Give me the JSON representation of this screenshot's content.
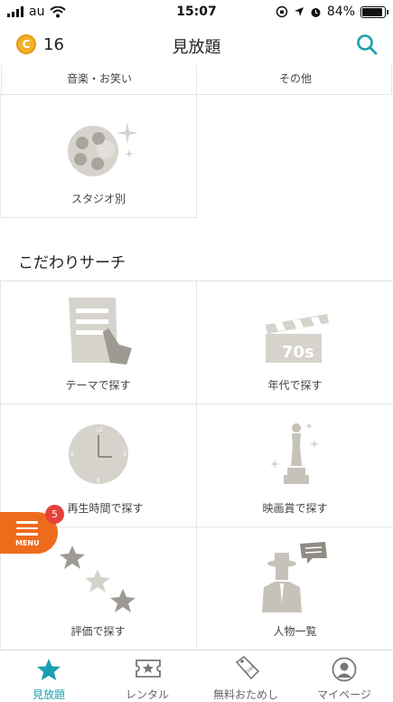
{
  "status": {
    "carrier": "au",
    "time": "15:07",
    "battery": "84%"
  },
  "header": {
    "coin_symbol": "C",
    "coins": "16",
    "title": "見放題"
  },
  "categories_top": {
    "left": "音楽・お笑い",
    "right": "その他"
  },
  "categories": [
    {
      "label": "スタジオ別"
    }
  ],
  "search_section": {
    "title": "こだわりサーチ",
    "items": [
      {
        "label": "テーマで探す",
        "icon": "document-hand-icon"
      },
      {
        "label": "年代で探す",
        "icon": "clapperboard-icon",
        "icon_text": "70s"
      },
      {
        "label": "再生時間で探す",
        "icon": "clock-icon"
      },
      {
        "label": "映画賞で探す",
        "icon": "trophy-icon"
      },
      {
        "label": "評価で探す",
        "icon": "stars-icon"
      },
      {
        "label": "人物一覧",
        "icon": "person-icon"
      }
    ]
  },
  "menu": {
    "label": "MENU",
    "badge": "5"
  },
  "tabs": [
    {
      "label": "見放題",
      "active": true
    },
    {
      "label": "レンタル"
    },
    {
      "label": "無料おためし"
    },
    {
      "label": "マイページ"
    }
  ],
  "colors": {
    "accent": "#1aa0b0",
    "menu": "#ee6b1c",
    "badge": "#e8403a",
    "icon_gray": "#d6d3cd"
  }
}
